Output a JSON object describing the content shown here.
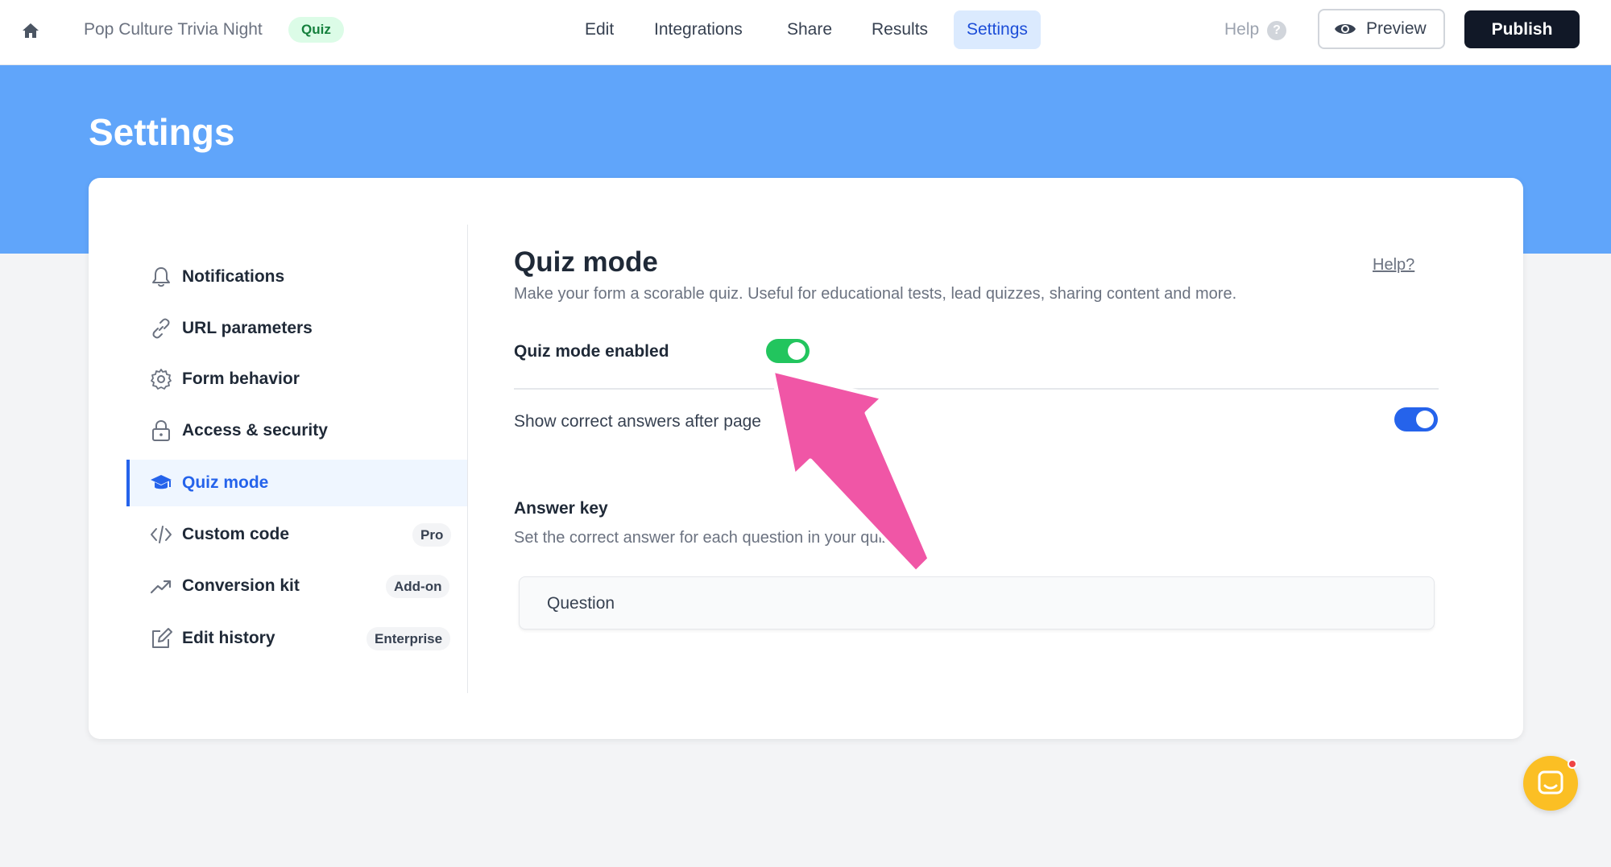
{
  "topbar": {
    "form_title": "Pop Culture Trivia Night",
    "badge": "Quiz",
    "tabs": [
      {
        "label": "Edit",
        "active": false
      },
      {
        "label": "Integrations",
        "active": false
      },
      {
        "label": "Share",
        "active": false
      },
      {
        "label": "Results",
        "active": false
      },
      {
        "label": "Settings",
        "active": true
      }
    ],
    "help_label": "Help",
    "help_icon": "?",
    "preview_label": "Preview",
    "publish_label": "Publish"
  },
  "page": {
    "title": "Settings"
  },
  "sidebar": {
    "items": [
      {
        "label": "Notifications",
        "icon": "bell-icon"
      },
      {
        "label": "URL parameters",
        "icon": "link-icon"
      },
      {
        "label": "Form behavior",
        "icon": "gear-icon"
      },
      {
        "label": "Access & security",
        "icon": "lock-icon"
      },
      {
        "label": "Quiz mode",
        "icon": "graduation-cap-icon",
        "active": true
      },
      {
        "label": "Custom code",
        "icon": "code-icon",
        "badge": "Pro"
      },
      {
        "label": "Conversion kit",
        "icon": "trending-up-icon",
        "badge": "Add-on"
      },
      {
        "label": "Edit history",
        "icon": "edit-icon",
        "badge": "Enterprise"
      }
    ]
  },
  "main": {
    "title": "Quiz mode",
    "help_link": "Help?",
    "description": "Make your form a scorable quiz. Useful for educational tests, lead quizzes, sharing content and more.",
    "quiz_toggle": {
      "label": "Quiz mode enabled",
      "on": true
    },
    "show_answers": {
      "label": "Show correct answers after page",
      "on": true,
      "help_icon": "?"
    },
    "answer_key": {
      "title": "Answer key",
      "description": "Set the correct answer for each question in your quiz.",
      "column_header": "Question"
    }
  },
  "colors": {
    "banner": "#60a5fa",
    "accent": "#2563eb",
    "toggle_green": "#22c55e",
    "arrow": "#f056a6",
    "chat": "#fbbf24"
  }
}
